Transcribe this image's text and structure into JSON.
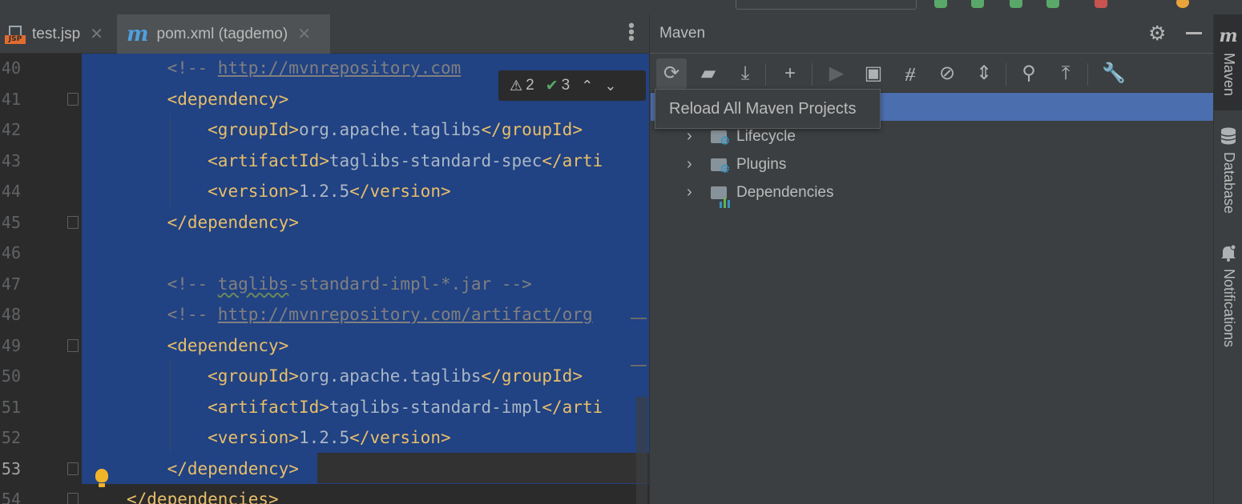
{
  "editor": {
    "tabs": [
      {
        "label": "test.jsp",
        "icon": "jsp-file-icon",
        "icon_text": "JSP",
        "active": false
      },
      {
        "label": "pom.xml (tagdemo)",
        "icon": "maven-file-icon",
        "icon_text": "m",
        "active": true
      }
    ],
    "close_glyph": "✕",
    "menu_glyph": "⋮",
    "inspection": {
      "warnings": "2",
      "typos": "3"
    },
    "lines": [
      {
        "num": "40",
        "segments": [
          {
            "t": "    ",
            "c": "plain"
          },
          {
            "t": "<!-- ",
            "c": "cmt"
          },
          {
            "t": "http://mvnrepository.com",
            "c": "url"
          }
        ]
      },
      {
        "num": "41",
        "segments": [
          {
            "t": "    ",
            "c": "plain"
          },
          {
            "t": "<dependency>",
            "c": "tag"
          }
        ]
      },
      {
        "num": "42",
        "segments": [
          {
            "t": "        ",
            "c": "plain"
          },
          {
            "t": "<groupId>",
            "c": "tag"
          },
          {
            "t": "org.apache.taglibs",
            "c": "plain"
          },
          {
            "t": "</groupId>",
            "c": "tag"
          }
        ]
      },
      {
        "num": "43",
        "segments": [
          {
            "t": "        ",
            "c": "plain"
          },
          {
            "t": "<artifactId>",
            "c": "tag"
          },
          {
            "t": "taglibs-standard-spec",
            "c": "plain"
          },
          {
            "t": "</arti",
            "c": "tag"
          }
        ]
      },
      {
        "num": "44",
        "segments": [
          {
            "t": "        ",
            "c": "plain"
          },
          {
            "t": "<version>",
            "c": "tag"
          },
          {
            "t": "1.2.5",
            "c": "plain"
          },
          {
            "t": "</version>",
            "c": "tag"
          }
        ]
      },
      {
        "num": "45",
        "segments": [
          {
            "t": "    ",
            "c": "plain"
          },
          {
            "t": "</dependency>",
            "c": "tag"
          }
        ]
      },
      {
        "num": "46",
        "segments": []
      },
      {
        "num": "47",
        "segments": [
          {
            "t": "    ",
            "c": "plain"
          },
          {
            "t": "<!-- ",
            "c": "cmt"
          },
          {
            "t": "taglibs",
            "c": "cmt squig"
          },
          {
            "t": "-standard-impl-*.jar -->",
            "c": "cmt"
          }
        ]
      },
      {
        "num": "48",
        "segments": [
          {
            "t": "    ",
            "c": "plain"
          },
          {
            "t": "<!-- ",
            "c": "cmt"
          },
          {
            "t": "http://mvnrepository.com/artifact/org",
            "c": "url"
          }
        ]
      },
      {
        "num": "49",
        "segments": [
          {
            "t": "    ",
            "c": "plain"
          },
          {
            "t": "<dependency>",
            "c": "tag"
          }
        ]
      },
      {
        "num": "50",
        "segments": [
          {
            "t": "        ",
            "c": "plain"
          },
          {
            "t": "<groupId>",
            "c": "tag"
          },
          {
            "t": "org.apache.taglibs",
            "c": "plain"
          },
          {
            "t": "</groupId>",
            "c": "tag"
          }
        ]
      },
      {
        "num": "51",
        "segments": [
          {
            "t": "        ",
            "c": "plain"
          },
          {
            "t": "<artifactId>",
            "c": "tag"
          },
          {
            "t": "taglibs-standard-impl",
            "c": "plain"
          },
          {
            "t": "</arti",
            "c": "tag"
          }
        ]
      },
      {
        "num": "52",
        "segments": [
          {
            "t": "        ",
            "c": "plain"
          },
          {
            "t": "<version>",
            "c": "tag"
          },
          {
            "t": "1.2.5",
            "c": "plain"
          },
          {
            "t": "</version>",
            "c": "tag"
          }
        ]
      },
      {
        "num": "53",
        "segments": [
          {
            "t": "    ",
            "c": "plain"
          },
          {
            "t": "</dependency>",
            "c": "tag"
          }
        ]
      },
      {
        "num": "54",
        "segments": [
          {
            "t": "</dependencies>",
            "c": "tag"
          }
        ]
      }
    ]
  },
  "maven": {
    "title": "Maven",
    "toolbar": [
      {
        "name": "reload-all-icon",
        "glyph": "⟳"
      },
      {
        "name": "generate-sources-icon",
        "glyph": "▰"
      },
      {
        "name": "download-icon",
        "glyph": "⤓"
      },
      {
        "name": "add-project-icon",
        "glyph": "+"
      },
      {
        "name": "run-icon",
        "glyph": "▶"
      },
      {
        "name": "execute-goal-icon",
        "glyph": "▣"
      },
      {
        "name": "toggle-offline-icon",
        "glyph": "⧣"
      },
      {
        "name": "skip-tests-icon",
        "glyph": "⊘"
      },
      {
        "name": "collapse-all-icon",
        "glyph": "⇕"
      },
      {
        "name": "analyze-dependencies-icon",
        "glyph": "⚲"
      },
      {
        "name": "show-dependencies-icon",
        "glyph": "⤒"
      },
      {
        "name": "settings-wrench-icon",
        "glyph": "🔧"
      }
    ],
    "tree": [
      {
        "label": "Lifecycle",
        "icon": "lifecycle-folder-icon"
      },
      {
        "label": "Plugins",
        "icon": "plugins-folder-icon"
      },
      {
        "label": "Dependencies",
        "icon": "dependencies-folder-icon"
      }
    ],
    "tooltip": "Reload All Maven Projects"
  },
  "right_strip": {
    "tabs": [
      {
        "label": "Maven",
        "icon": "m"
      },
      {
        "label": "Database",
        "icon": "database-icon"
      },
      {
        "label": "Notifications",
        "icon": "bell-icon"
      }
    ]
  },
  "colors": {
    "selection": "#214283",
    "tree_selection": "#4b6eaf",
    "xml_tag": "#e8bf6a",
    "comment": "#808080"
  }
}
